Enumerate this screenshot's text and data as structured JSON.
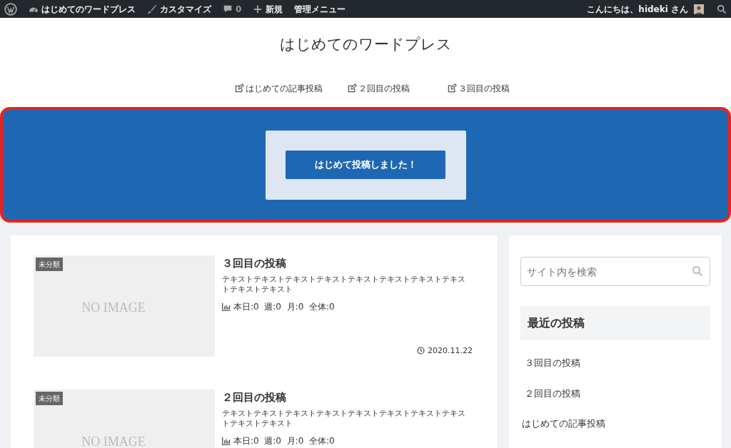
{
  "admin_bar": {
    "items": [
      {
        "kind": "wp-logo"
      },
      {
        "kind": "site",
        "label": "はじめてのワードプレス"
      },
      {
        "kind": "customize",
        "label": "カスタマイズ"
      },
      {
        "kind": "comments",
        "label": "0"
      },
      {
        "kind": "new",
        "label": "新規"
      },
      {
        "kind": "menu",
        "label": "管理メニュー"
      }
    ],
    "greeting": "こんにちは、hideki さん"
  },
  "site_title": "はじめてのワードプレス",
  "nav": [
    {
      "label": "はじめての記事投稿"
    },
    {
      "label": "２回目の投稿"
    },
    {
      "label": "３回目の投稿"
    }
  ],
  "banner": {
    "button": "はじめて投稿しました！",
    "highlighted": true
  },
  "posts": [
    {
      "category": "未分類",
      "thumbnail": "NO IMAGE",
      "title": "３回目の投稿",
      "excerpt": "テキストテキストテキストテキストテキストテキストテキストテキストテキストテキスト",
      "stats": "本日:0  週:0  月:0  全体:0",
      "date": "2020.11.22"
    },
    {
      "category": "未分類",
      "thumbnail": "NO IMAGE",
      "title": "２回目の投稿",
      "excerpt": "テキストテキストテキストテキストテキストテキストテキストテキストテキストテキスト",
      "stats": "本日:0  週:0  月:0  全体:0"
    }
  ],
  "sidebar": {
    "search": {
      "placeholder": "サイト内を検索"
    },
    "recent_title": "最近の投稿",
    "recent": [
      "３回目の投稿",
      "２回目の投稿",
      "はじめての記事投稿"
    ]
  }
}
